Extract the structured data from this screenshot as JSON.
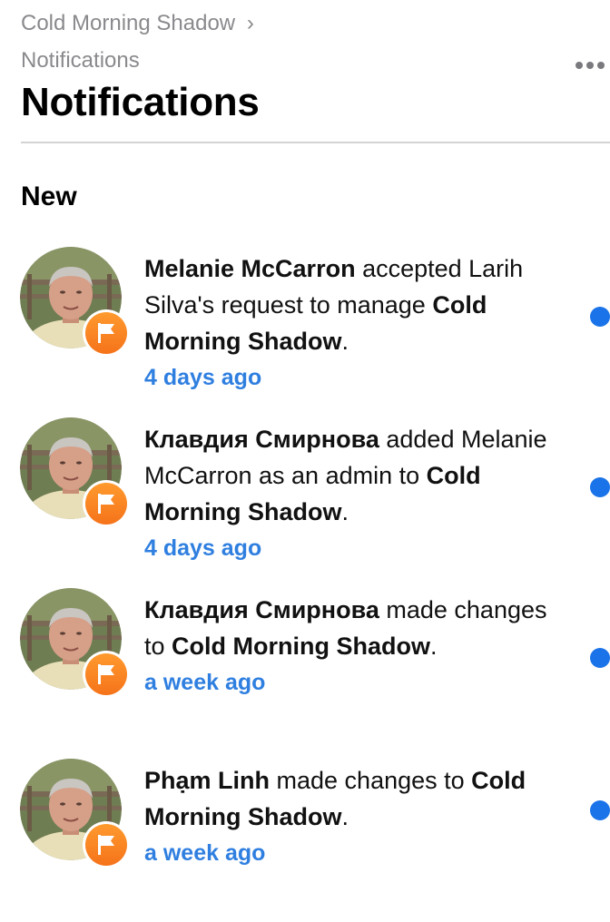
{
  "header": {
    "breadcrumb_parent": "Cold Morning Shadow",
    "breadcrumb_separator": "›",
    "breadcrumb_current": "Notifications",
    "title": "Notifications",
    "more_icon": "more-horizontal-icon"
  },
  "section": {
    "title": "New"
  },
  "notifications": [
    {
      "segments": [
        {
          "text": "Melanie McCarron",
          "bold": true
        },
        {
          "text": " accepted Larih Silva's request to manage ",
          "bold": false
        },
        {
          "text": "Cold Morning Shadow",
          "bold": true
        },
        {
          "text": ".",
          "bold": false
        }
      ],
      "time": "4 days ago",
      "unread": true
    },
    {
      "segments": [
        {
          "text": "Клавдия Смирнова",
          "bold": true
        },
        {
          "text": " added Melanie McCarron as an admin to ",
          "bold": false
        },
        {
          "text": "Cold Morning Shadow",
          "bold": true
        },
        {
          "text": ".",
          "bold": false
        }
      ],
      "time": "4 days ago",
      "unread": true
    },
    {
      "segments": [
        {
          "text": "Клавдия Смирнова",
          "bold": true
        },
        {
          "text": " made changes to ",
          "bold": false
        },
        {
          "text": "Cold Morning Shadow",
          "bold": true
        },
        {
          "text": ".",
          "bold": false
        }
      ],
      "time": "a week ago",
      "unread": true
    },
    {
      "segments": [
        {
          "text": "Phạm Linh",
          "bold": true
        },
        {
          "text": " made changes to ",
          "bold": false
        },
        {
          "text": "Cold Morning Shadow",
          "bold": true
        },
        {
          "text": ".",
          "bold": false
        }
      ],
      "time": "a week ago",
      "unread": true
    }
  ],
  "colors": {
    "accent_time": "#2f7fe0",
    "unread_dot": "#1a73e8",
    "badge": "#f5731a"
  },
  "badge_icon": "page-flag-icon"
}
